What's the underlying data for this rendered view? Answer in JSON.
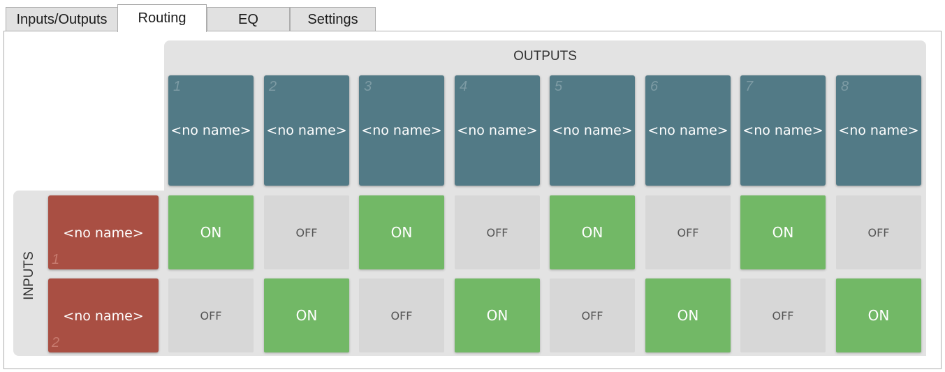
{
  "tabs": [
    {
      "label": "Inputs/Outputs",
      "active": false
    },
    {
      "label": "Routing",
      "active": true
    },
    {
      "label": "EQ",
      "active": false
    },
    {
      "label": "Settings",
      "active": false
    }
  ],
  "routing": {
    "outputs_label": "OUTPUTS",
    "inputs_label": "INPUTS",
    "outputs": [
      {
        "number": "1",
        "name": "<no name>"
      },
      {
        "number": "2",
        "name": "<no name>"
      },
      {
        "number": "3",
        "name": "<no name>"
      },
      {
        "number": "4",
        "name": "<no name>"
      },
      {
        "number": "5",
        "name": "<no name>"
      },
      {
        "number": "6",
        "name": "<no name>"
      },
      {
        "number": "7",
        "name": "<no name>"
      },
      {
        "number": "8",
        "name": "<no name>"
      }
    ],
    "inputs": [
      {
        "number": "1",
        "name": "<no name>"
      },
      {
        "number": "2",
        "name": "<no name>"
      }
    ],
    "matrix": [
      [
        "ON",
        "OFF",
        "ON",
        "OFF",
        "ON",
        "OFF",
        "ON",
        "OFF"
      ],
      [
        "OFF",
        "ON",
        "OFF",
        "ON",
        "OFF",
        "ON",
        "OFF",
        "ON"
      ]
    ]
  },
  "colors": {
    "output_tile": "#527a86",
    "input_tile": "#a94f43",
    "on": "#72b866",
    "off": "#d7d7d7",
    "group_bg": "#e3e3e3"
  }
}
